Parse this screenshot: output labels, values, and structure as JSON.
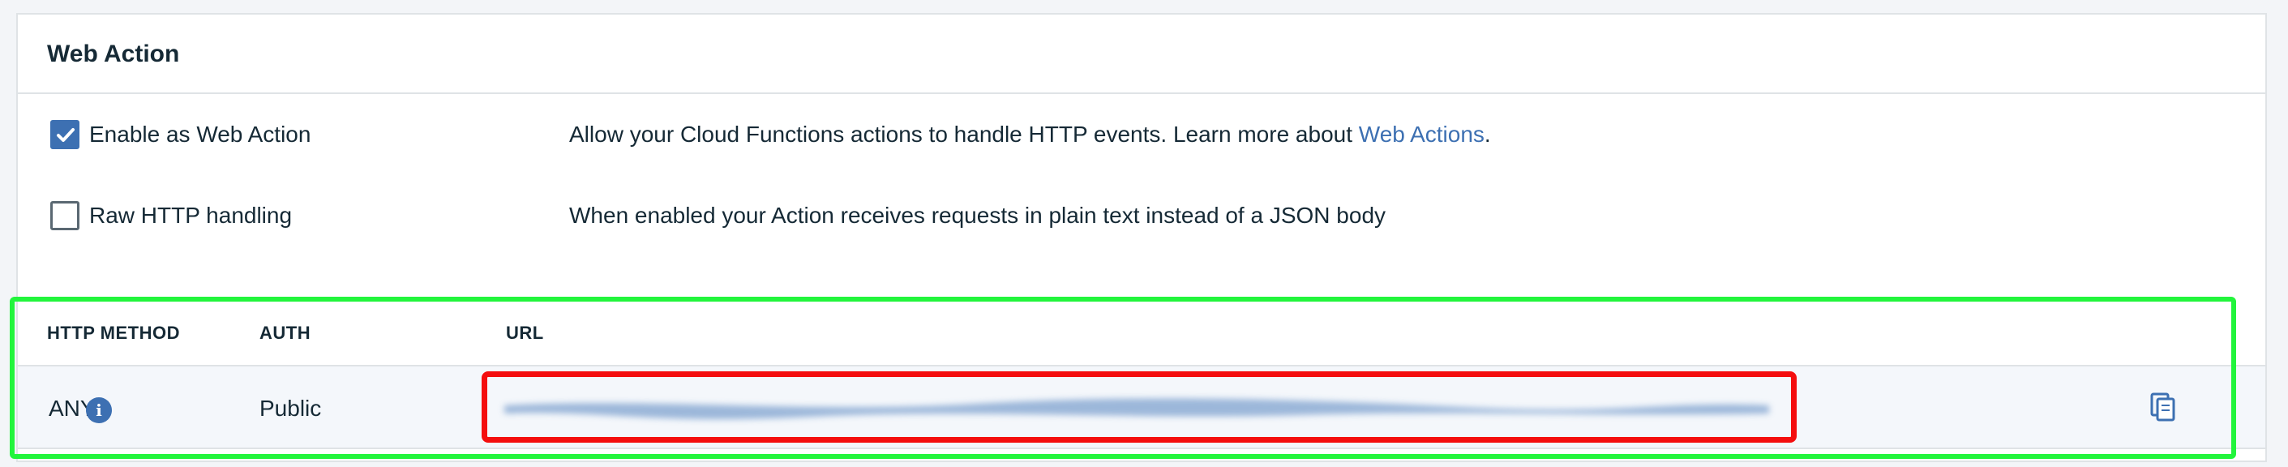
{
  "panel": {
    "title": "Web Action"
  },
  "options": [
    {
      "label": "Enable as Web Action",
      "checked": true,
      "description": "Allow your Cloud Functions actions to handle HTTP events. Learn more about ",
      "link_text": "Web Actions",
      "description_end": "."
    },
    {
      "label": "Raw HTTP handling",
      "checked": false,
      "description": "When enabled your Action receives requests in plain text instead of a JSON body"
    }
  ],
  "table": {
    "headers": [
      "HTTP METHOD",
      "AUTH",
      "URL"
    ],
    "rows": [
      {
        "method": "ANY",
        "auth": "Public",
        "info_icon": "info-icon",
        "copy_icon": "copy-icon"
      }
    ]
  },
  "colors": {
    "accent": "#3d70b2",
    "highlight_outer": "#22f53c",
    "highlight_inner": "#f40e0e"
  }
}
